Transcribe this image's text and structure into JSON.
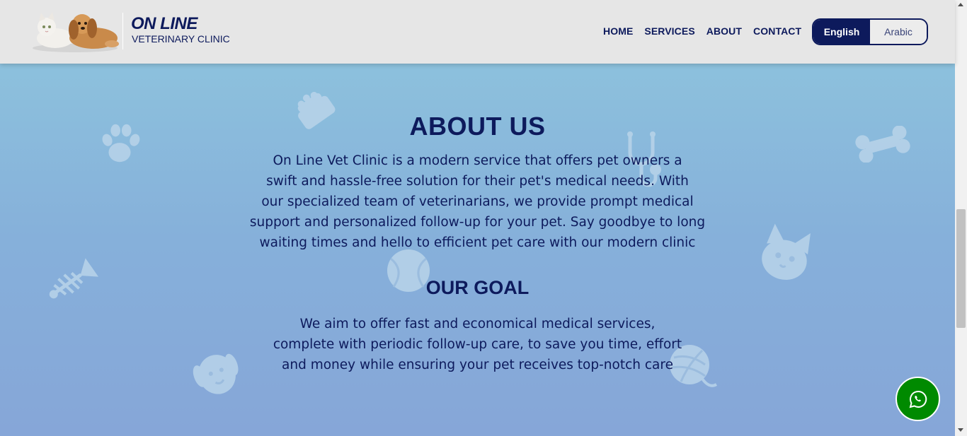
{
  "brand": {
    "title": "ON LINE",
    "subtitle": "VETERINARY CLINIC"
  },
  "nav": {
    "items": [
      {
        "label": "HOME"
      },
      {
        "label": "SERVICES"
      },
      {
        "label": "ABOUT"
      },
      {
        "label": "CONTACT"
      }
    ]
  },
  "language": {
    "active": "English",
    "other": "Arabic"
  },
  "about": {
    "title": "ABOUT US",
    "lines": [
      "On Line Vet Clinic is a modern service that offers pet owners a",
      "swift and hassle-free solution for their pet's medical needs. With",
      "our specialized team of veterinarians, we provide prompt medical",
      "support and personalized follow-up for your pet. Say goodbye to long",
      "waiting times and hello to efficient pet care with our modern clinic"
    ]
  },
  "goal": {
    "title": "OUR GOAL",
    "lines": [
      "We aim to offer fast and economical medical services,",
      "complete with periodic follow-up care, to save you time, effort",
      "and money while ensuring your pet receives top-notch care"
    ]
  },
  "icons": {
    "whatsapp": "whatsapp-icon",
    "decor": [
      "paw-icon",
      "food-bowl-icon",
      "stethoscope-icon",
      "bone-icon",
      "fish-bone-icon",
      "ball-icon",
      "cat-face-icon",
      "dog-face-icon",
      "yarn-ball-icon"
    ]
  },
  "colors": {
    "primary": "#0d1a5c",
    "header_bg": "#e6e6e6",
    "whatsapp": "#008a00"
  }
}
